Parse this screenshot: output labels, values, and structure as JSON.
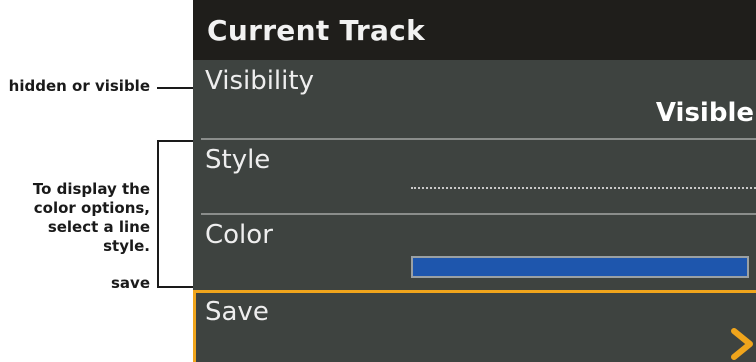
{
  "callouts": {
    "visibility": "hidden or visible",
    "style_line1": "To display the",
    "style_line2": "color options,",
    "style_line3": "select a line style.",
    "save": "save"
  },
  "panel": {
    "title": "Current Track",
    "visibility_label": "Visibility",
    "visibility_value": "Visible",
    "style_label": "Style",
    "color_label": "Color",
    "save_label": "Save"
  },
  "colors": {
    "panel_bg": "#3e4340",
    "header_bg": "#1f1e1b",
    "highlight": "#f0a51c",
    "track_color": "#1e56ad"
  },
  "icons": {
    "save_arrow": "chevron-right-icon"
  }
}
